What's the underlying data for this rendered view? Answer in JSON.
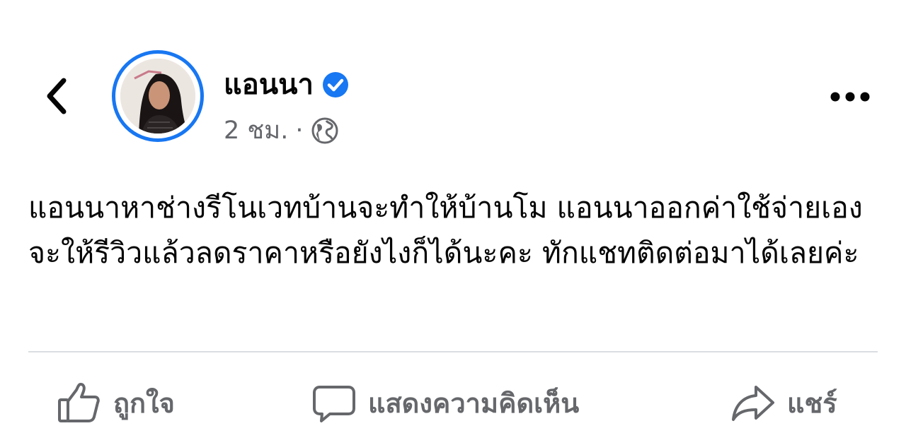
{
  "post": {
    "author": "แอนนา",
    "verified": true,
    "time": "2 ชม.",
    "separator": "·",
    "privacy_icon": "globe-icon",
    "body": "แอนนาหาช่างรีโนเวทบ้านจะทำให้บ้านโม แอนนาออกค่าใช้จ่ายเอง จะให้รีวิวแล้วลดราคาหรือยังไงก็ได้นะคะ ทักแชทติดต่อมาได้เลยค่ะ"
  },
  "actions": {
    "like_label": "ถูกใจ",
    "comment_label": "แสดงความคิดเห็น",
    "share_label": "แชร์"
  },
  "colors": {
    "accent": "#1877f2",
    "secondary_text": "#65676b",
    "divider": "#dadde1"
  }
}
